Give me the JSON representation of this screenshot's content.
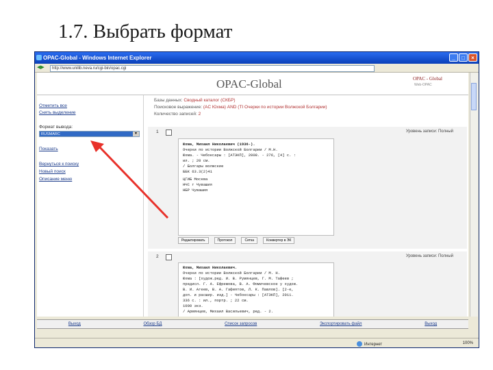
{
  "slide": {
    "title": "1.7. Выбрать формат"
  },
  "browser": {
    "window_title": "OPAC-Global - Windows Internet Explorer",
    "url": "http://www.unilib.neva.ru/cgi-bin/opac.cgi",
    "status_zone": "Интернет",
    "zoom": "100%"
  },
  "banner": {
    "logo": "OPAC-Global",
    "right_logo": "OPAC - Global",
    "right_sub": "Web-OPAC"
  },
  "sidebar": {
    "mark_all": "Отметить все",
    "unmark": "Снять выделение",
    "format_label": "Формат вывода:",
    "format_value": "RUSMARC",
    "show": "Показать",
    "back": "Вернуться к поиску",
    "new_search": "Новый поиск",
    "help": "Описание меню"
  },
  "info": {
    "k1": "Базы данных:",
    "v1": "Сводный каталог (СКБР)",
    "k2": "Поисковое выражение:",
    "v2": "(AC Юхма) AND (TI Очерки по истории Волжской Болгарии)",
    "k3": "Количество записей:",
    "v3": "2"
  },
  "records": [
    {
      "num": "1",
      "level": "Уровень записи: Полный",
      "lines": [
        "Юхма, Михаил Николаевич (1936-).",
        "  Очерки по истории Волжской Болгарии / М.Н.",
        "Юхма. - Чебоксары : [АТЭКП], 2008. - 276, [4] с. :",
        "ил. ; 20 см.",
        "  / Болгары волжские",
        "                              ББК 63.3(2)41",
        "ЦГИБ Москва",
        "НЧС г Чувашия",
        "НБР Чувашия"
      ],
      "actions": [
        "Редактировать",
        "Протокол",
        "Сетка",
        "Конвертер в ЭК"
      ]
    },
    {
      "num": "2",
      "level": "Уровень записи: Полный",
      "lines": [
        "Юхма, Михаил Николаевич.",
        "  Очерки по истории Волжской Болгарии / М. Н.",
        "Юхма : [худож.ред. И. В. Румянцев, Г. М. Тафеев ;",
        "предисл. Г. А. Ефремова, В. А. Фомичевское у худож.",
        "В. И. Агеев, В. А. Гафиятов, Л. К. Павлов]. [2-е,",
        "доп. и расшир. изд.] - Чебоксары : [АТЭКП], 2011.",
        "  336 с. : ил., портр. ; 22 см.",
        "  1000 экз.",
        "  / Армянцев, Михаил Васильевич, ред. - 2."
      ]
    }
  ],
  "bottom": {
    "exit": "Выход",
    "about": "Обзор БД",
    "search_list": "Список запросов",
    "export": "Экспортировать файл",
    "logout": "Выход"
  },
  "annotation": {
    "arrow_color": "#e8312a"
  }
}
